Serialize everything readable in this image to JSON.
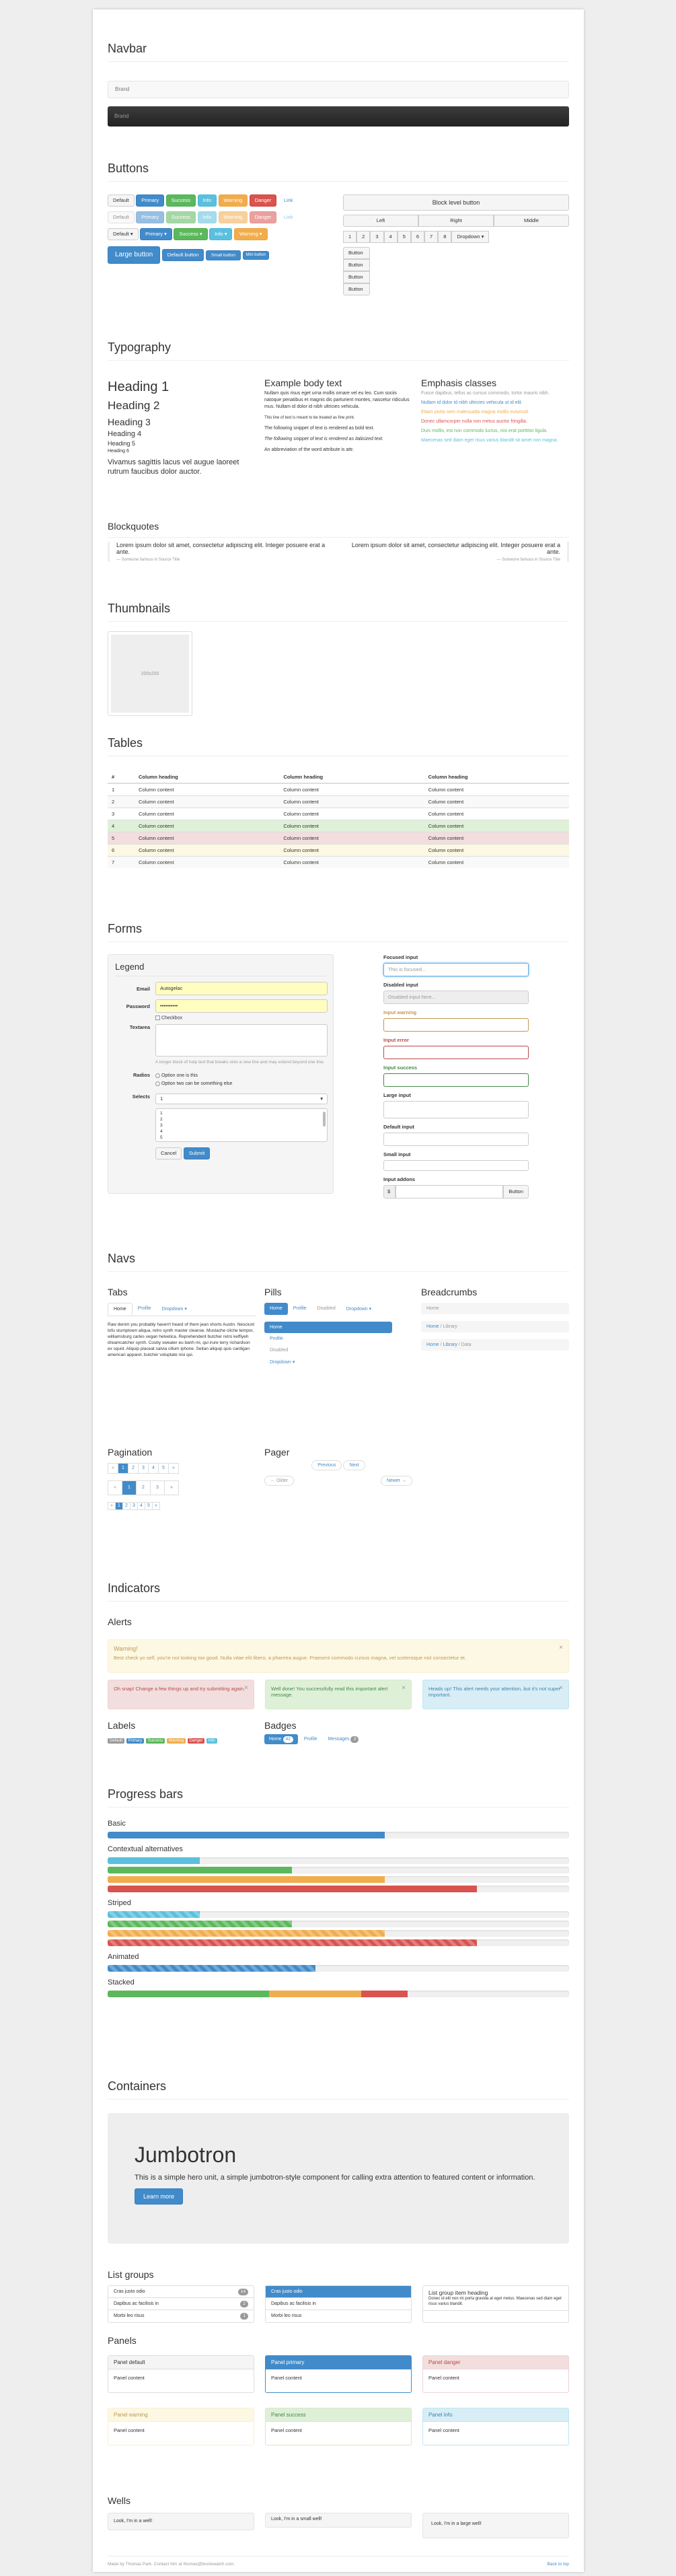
{
  "navbar": {
    "title": "Navbar",
    "brand_light": "Brand",
    "brand_dark": "Brand"
  },
  "buttons": {
    "title": "Buttons",
    "row1": [
      "Default",
      "Primary",
      "Success",
      "Info",
      "Warning",
      "Danger",
      "Link"
    ],
    "row3": [
      "Default",
      "Primary",
      "Success",
      "Info",
      "Warning"
    ],
    "sizes": [
      "Large button",
      "Default button",
      "Small button",
      "Mini button"
    ],
    "block": "Block level button",
    "justified": [
      "Left",
      "Right",
      "Middle"
    ],
    "pages": [
      "1",
      "2",
      "3",
      "4",
      "5",
      "6",
      "7",
      "8"
    ],
    "dropdown": "Dropdown",
    "vertical": [
      "Button",
      "Button",
      "Button",
      "Button"
    ]
  },
  "typography": {
    "title": "Typography",
    "headings": [
      "Heading 1",
      "Heading 2",
      "Heading 3",
      "Heading 4",
      "Heading 5",
      "Heading 6"
    ],
    "lead": "Vivamus sagittis lacus vel augue laoreet rutrum faucibus dolor auctor.",
    "body_title": "Example body text",
    "body_p1": "Nullam quis risus eget urna mollis ornare vel eu leo. Cum sociis natoque penatibus et magnis dis parturient montes, nascetur ridiculus mus. Nullam id dolor id nibh ultricies vehicula.",
    "body_small": "This line of text is meant to be treated as fine print.",
    "body_bold": "The following snippet of text is rendered as bold text.",
    "body_italic": "The following snippet of text is rendered as italicized text.",
    "body_abbr": "An abbreviation of the word attribute is attr.",
    "emph_title": "Emphasis classes",
    "emph": [
      "Fusce dapibus, tellus ac cursus commodo, tortor mauris nibh.",
      "Nullam id dolor id nibh ultricies vehicula ut id elit.",
      "Etiam porta sem malesuada magna mollis euismod.",
      "Donec ullamcorper nulla non metus auctor fringilla.",
      "Duis mollis, est non commodo luctus, nisi erat porttitor ligula.",
      "Maecenas sed diam eget risus varius blandit sit amet non magna."
    ],
    "bq_title": "Blockquotes",
    "bq_text": "Lorem ipsum dolor sit amet, consectetur adipiscing elit. Integer posuere erat a ante.",
    "bq_src": "— Someone famous in Source Title"
  },
  "thumbnails": {
    "title": "Thumbnails",
    "caption": "200x200"
  },
  "tables": {
    "title": "Tables",
    "headers": [
      "#",
      "Column heading",
      "Column heading",
      "Column heading"
    ],
    "rows": [
      [
        "1",
        "Column content",
        "Column content",
        "Column content"
      ],
      [
        "2",
        "Column content",
        "Column content",
        "Column content"
      ],
      [
        "3",
        "Column content",
        "Column content",
        "Column content"
      ],
      [
        "4",
        "Column content",
        "Column content",
        "Column content"
      ],
      [
        "5",
        "Column content",
        "Column content",
        "Column content"
      ],
      [
        "6",
        "Column content",
        "Column content",
        "Column content"
      ],
      [
        "7",
        "Column content",
        "Column content",
        "Column content"
      ]
    ],
    "row_colors": [
      "#fff",
      "#f9f9f9",
      "#fff",
      "#dff0d8",
      "#f2dede",
      "#fcf8e3",
      "#f9f9f9"
    ]
  },
  "forms": {
    "title": "Forms",
    "legend": "Legend",
    "email_label": "Email",
    "email_value": "Autogelac",
    "password_label": "Password",
    "password_value": "••••••••••",
    "checkbox": "Checkbox",
    "textarea_label": "Textarea",
    "help": "A longer block of help text that breaks onto a new line and may extend beyond one line.",
    "radios_label": "Radios",
    "radio1": "Option one is this",
    "radio2": "Option two can be something else",
    "selects_label": "Selects",
    "select_value": "1",
    "multi": [
      "1",
      "2",
      "3",
      "4",
      "5"
    ],
    "cancel": "Cancel",
    "submit": "Submit",
    "focused_label": "Focused input",
    "focused_ph": "This is focused...",
    "disabled_label": "Disabled input",
    "disabled_ph": "Disabled input here...",
    "warning_label": "Input warning",
    "error_label": "Input error",
    "success_label": "Input success",
    "large_label": "Large input",
    "default_label": "Default input",
    "small_label": "Small input",
    "addon_label": "Input addons",
    "addon_left": "$",
    "addon_btn": "Button"
  },
  "navs": {
    "title": "Navs",
    "tabs_title": "Tabs",
    "tabs": [
      "Home",
      "Profile",
      "Dropdown ▾"
    ],
    "tab_text": "Raw denim you probably haven't heard of them jean shorts Austin. Nesciunt tofu stumptown aliqua, retro synth master cleanse. Mustache cliche tempor, williamsburg carles vegan helvetica. Reprehenderit butcher retro keffiyeh dreamcatcher synth. Cosby sweater eu banh mi, qui irure terry richardson ex squid. Aliquip placeat salvia cillum iphone. Seitan aliquip quis cardigan american apparel, butcher voluptate nisi qui.",
    "pills_title": "Pills",
    "pills": [
      "Home",
      "Profile",
      "Disabled",
      "Dropdown ▾"
    ],
    "stacked": [
      "Home",
      "Profile",
      "Disabled",
      "Dropdown ▾"
    ],
    "bc_title": "Breadcrumbs",
    "bc1": [
      "Home"
    ],
    "bc2": [
      "Home",
      "Library"
    ],
    "bc3": [
      "Home",
      "Library",
      "Data"
    ],
    "pag_title": "Pagination",
    "pager_title": "Pager",
    "pager1": [
      "Previous",
      "Next"
    ],
    "pager2": [
      "← Older",
      "Newer →"
    ],
    "pag": [
      "«",
      "1",
      "2",
      "3",
      "4",
      "5",
      "»"
    ],
    "pag_lg": [
      "«",
      "1",
      "2",
      "3",
      "»"
    ]
  },
  "indicators": {
    "title": "Indicators",
    "alerts_title": "Alerts",
    "warn_head": "Warning!",
    "warn_text": "Best check yo self, you're not looking too good. Nulla vitae elit libero, a pharetra augue. Praesent commodo cursus magna, vel scelerisque nisl consectetur et.",
    "danger_text": "Oh snap! Change a few things up and try submitting again.",
    "success_text": "Well done! You successfully read this important alert message.",
    "info_text": "Heads up! This alert needs your attention, but it's not super important.",
    "labels_title": "Labels",
    "labels": [
      "Default",
      "Primary",
      "Success",
      "Warning",
      "Danger",
      "Info"
    ],
    "badges_title": "Badges",
    "badges": [
      "Home",
      "Profile",
      "Messages"
    ],
    "badge_counts": [
      "42",
      "",
      "3"
    ]
  },
  "progress": {
    "title": "Progress bars",
    "basic": "Basic",
    "contextual": "Contextual alternatives",
    "striped": "Striped",
    "animated": "Animated",
    "stacked": "Stacked",
    "basic_value": 60,
    "contextual_values": [
      20,
      40,
      60,
      80
    ],
    "striped_values": [
      20,
      40,
      60,
      80
    ],
    "animated_value": 45,
    "stacked_values": [
      35,
      20,
      10
    ],
    "colors": [
      "#5bc0de",
      "#5cb85c",
      "#f0ad4e",
      "#d9534f"
    ]
  },
  "containers": {
    "title": "Containers",
    "jumbo_title": "Jumbotron",
    "jumbo_text": "This is a simple hero unit, a simple jumbotron-style component for calling extra attention to featured content or information.",
    "jumbo_btn": "Learn more",
    "lg_title": "List groups",
    "lg1": [
      "Cras justo odio",
      "Dapibus ac facilisis in",
      "Morbi leo risus"
    ],
    "lg1_badges": [
      "14",
      "2",
      "1"
    ],
    "lg2": [
      "Cras justo odio",
      "Dapibus ac facilisis in",
      "Morbi leo risus"
    ],
    "lg3_head": "List group item heading",
    "lg3_text": "Donec id elit non mi porta gravida at eget metus. Maecenas sed diam eget risus varius blandit.",
    "panels_title": "Panels",
    "panels": [
      "Panel default",
      "Panel primary",
      "Panel danger",
      "Panel warning",
      "Panel success",
      "Panel info"
    ],
    "panel_content": "Panel content",
    "wells_title": "Wells",
    "wells": [
      "Look, I'm in a well!",
      "Look, I'm in a small well!",
      "Look, I'm in a large well!"
    ]
  },
  "footer": {
    "made": "Made by Thomas Park. Contact him at thomas@bootswatch.com.",
    "back": "Back to top"
  }
}
